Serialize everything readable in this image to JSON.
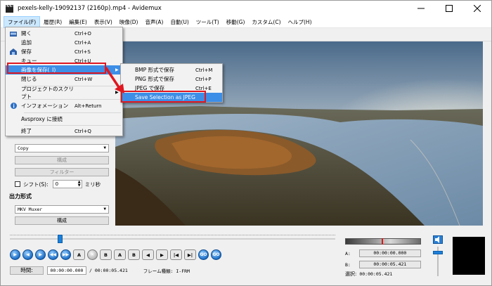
{
  "window": {
    "title": "pexels-kelly-19092137 (2160p).mp4 - Avidemux"
  },
  "menubar": [
    "ファイル(F)",
    "履歴(R)",
    "編集(E)",
    "表示(V)",
    "映像(D)",
    "音声(A)",
    "自動(U)",
    "ツール(T)",
    "移動(G)",
    "カスタム(C)",
    "ヘルプ(H)"
  ],
  "file_menu": {
    "items": [
      {
        "label": "開く",
        "shortcut": "Ctrl+O",
        "icon": "folder-open-icon"
      },
      {
        "label": "追加",
        "shortcut": "Ctrl+A",
        "icon": ""
      },
      {
        "label": "保存",
        "shortcut": "Ctrl+S",
        "icon": "save-icon"
      },
      {
        "label": "キュー",
        "shortcut": "Ctrl+U",
        "icon": ""
      },
      {
        "label": "画像を保存(_I)",
        "shortcut": "",
        "icon": "",
        "submenu": true
      },
      {
        "label": "閉じる",
        "shortcut": "Ctrl+W",
        "icon": ""
      },
      {
        "label": "プロジェクトのスクリプト",
        "shortcut": "",
        "icon": "",
        "submenu": true
      },
      {
        "label": "インフォメーション",
        "shortcut": "Alt+Return",
        "icon": "info-icon"
      },
      {
        "label": "Avsproxy に接続",
        "shortcut": "",
        "icon": ""
      },
      {
        "label": "終了",
        "shortcut": "Ctrl+Q",
        "icon": ""
      }
    ]
  },
  "save_image_submenu": {
    "items": [
      {
        "label": "BMP 形式で保存",
        "shortcut": "Ctrl+M"
      },
      {
        "label": "PNG 形式で保存",
        "shortcut": "Ctrl+P"
      },
      {
        "label": "JPEG で保存",
        "shortcut": "Ctrl+E"
      },
      {
        "label": "Save Selection as JPEG",
        "shortcut": ""
      }
    ]
  },
  "left_panel": {
    "video_output_select": "Copy",
    "configure_label": "構成",
    "filters_label": "フィルター",
    "shift_label": "シフト(S):",
    "shift_value": "0",
    "shift_unit": "ミリ秒",
    "output_format_heading": "出力形式",
    "output_format_select": "MKV Muxer",
    "configure2_label": "構成"
  },
  "bottom": {
    "time_button": "時間:",
    "current_time": "00:00:00.000",
    "total_time": "/ 00:00:05.421",
    "frame_type": "フレーム種類: I-FRM",
    "seek_position": 0.146,
    "volume_position": 0.15,
    "a_label": "A:",
    "a_value": "00:00:00.000",
    "b_label": "B:",
    "b_value": "00:00:05.421",
    "selection_label": "選択:",
    "selection_value": "00:00:05.421"
  },
  "controls": [
    {
      "icon": "play-icon",
      "text": "▶"
    },
    {
      "icon": "previous-frame-icon",
      "text": "◀"
    },
    {
      "icon": "next-frame-icon",
      "text": "▶"
    },
    {
      "icon": "rewind-icon",
      "text": "◀◀"
    },
    {
      "icon": "fast-forward-icon",
      "text": "▶▶"
    },
    {
      "icon": "set-marker-a-icon",
      "text": "A"
    },
    {
      "icon": "delete-icon",
      "text": "✕"
    },
    {
      "icon": "set-marker-b-icon",
      "text": "B"
    },
    {
      "icon": "goto-marker-a-icon",
      "text": "A"
    },
    {
      "icon": "goto-marker-b-icon",
      "text": "B"
    },
    {
      "icon": "prev-keyframe-icon",
      "text": "◀"
    },
    {
      "icon": "next-keyframe-icon",
      "text": "▶"
    },
    {
      "icon": "first-frame-icon",
      "text": "|◀"
    },
    {
      "icon": "last-frame-icon",
      "text": "▶|"
    },
    {
      "icon": "go-back-icon",
      "text": "GO"
    },
    {
      "icon": "go-forward-icon",
      "text": "GO"
    }
  ],
  "colors": {
    "highlight": "#3d8ee6",
    "annotation_red": "#e0171f",
    "blue_button": "#1d6fc7"
  }
}
